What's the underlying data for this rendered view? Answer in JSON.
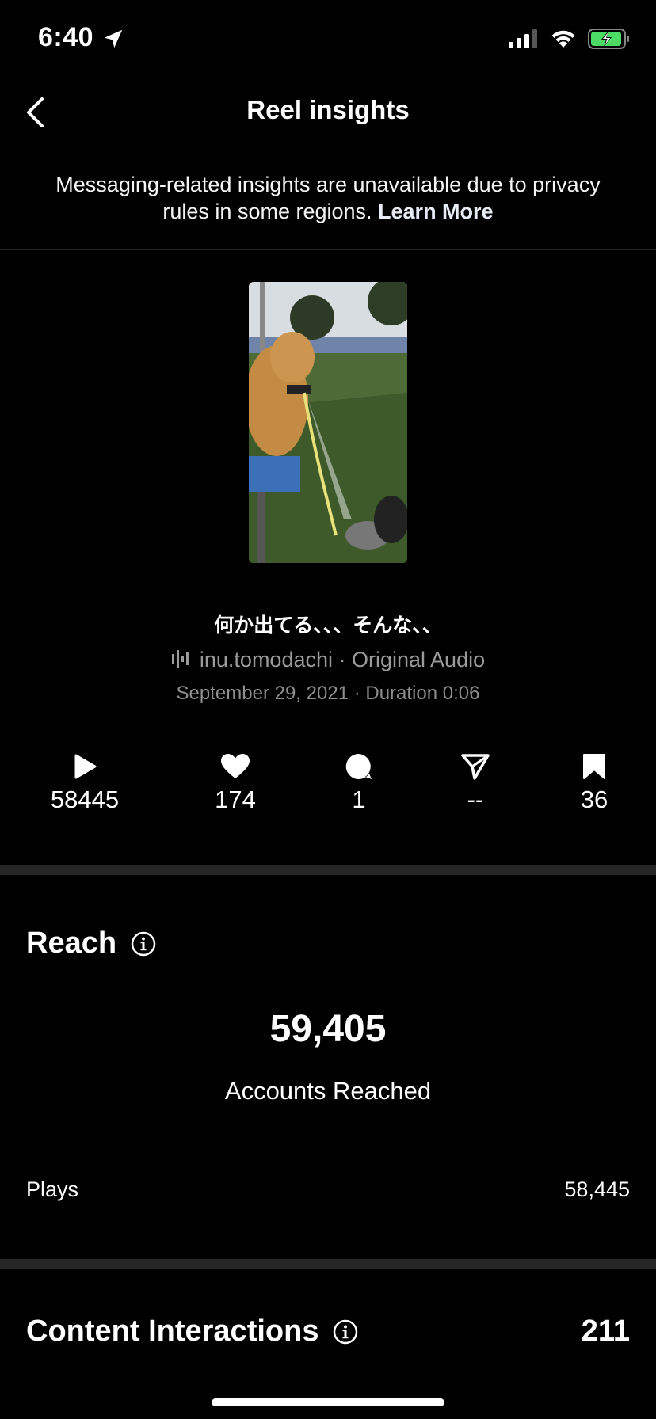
{
  "status_bar": {
    "time": "6:40"
  },
  "header": {
    "title": "Reel insights"
  },
  "notice": {
    "text": "Messaging-related insights are unavailable due to privacy rules in some regions. ",
    "link": "Learn More"
  },
  "reel": {
    "caption": "何か出てる、、、そんな、、",
    "audio_owner": "inu.tomodachi",
    "audio_name": "Original Audio",
    "date": "September 29, 2021",
    "duration": "Duration 0:06"
  },
  "stats": [
    {
      "icon": "play-icon",
      "value": "58445"
    },
    {
      "icon": "heart-icon",
      "value": "174"
    },
    {
      "icon": "comment-icon",
      "value": "1"
    },
    {
      "icon": "share-icon",
      "value": "--"
    },
    {
      "icon": "bookmark-icon",
      "value": "36"
    }
  ],
  "reach": {
    "title": "Reach",
    "accounts_reached_value": "59,405",
    "accounts_reached_label": "Accounts Reached",
    "plays_label": "Plays",
    "plays_value": "58,445"
  },
  "content_interactions": {
    "title": "Content Interactions",
    "value": "211"
  },
  "colors": {
    "background": "#000000",
    "text": "#ffffff",
    "muted": "#9a9a9a",
    "divider": "#262626",
    "battery_green": "#4cd964"
  }
}
